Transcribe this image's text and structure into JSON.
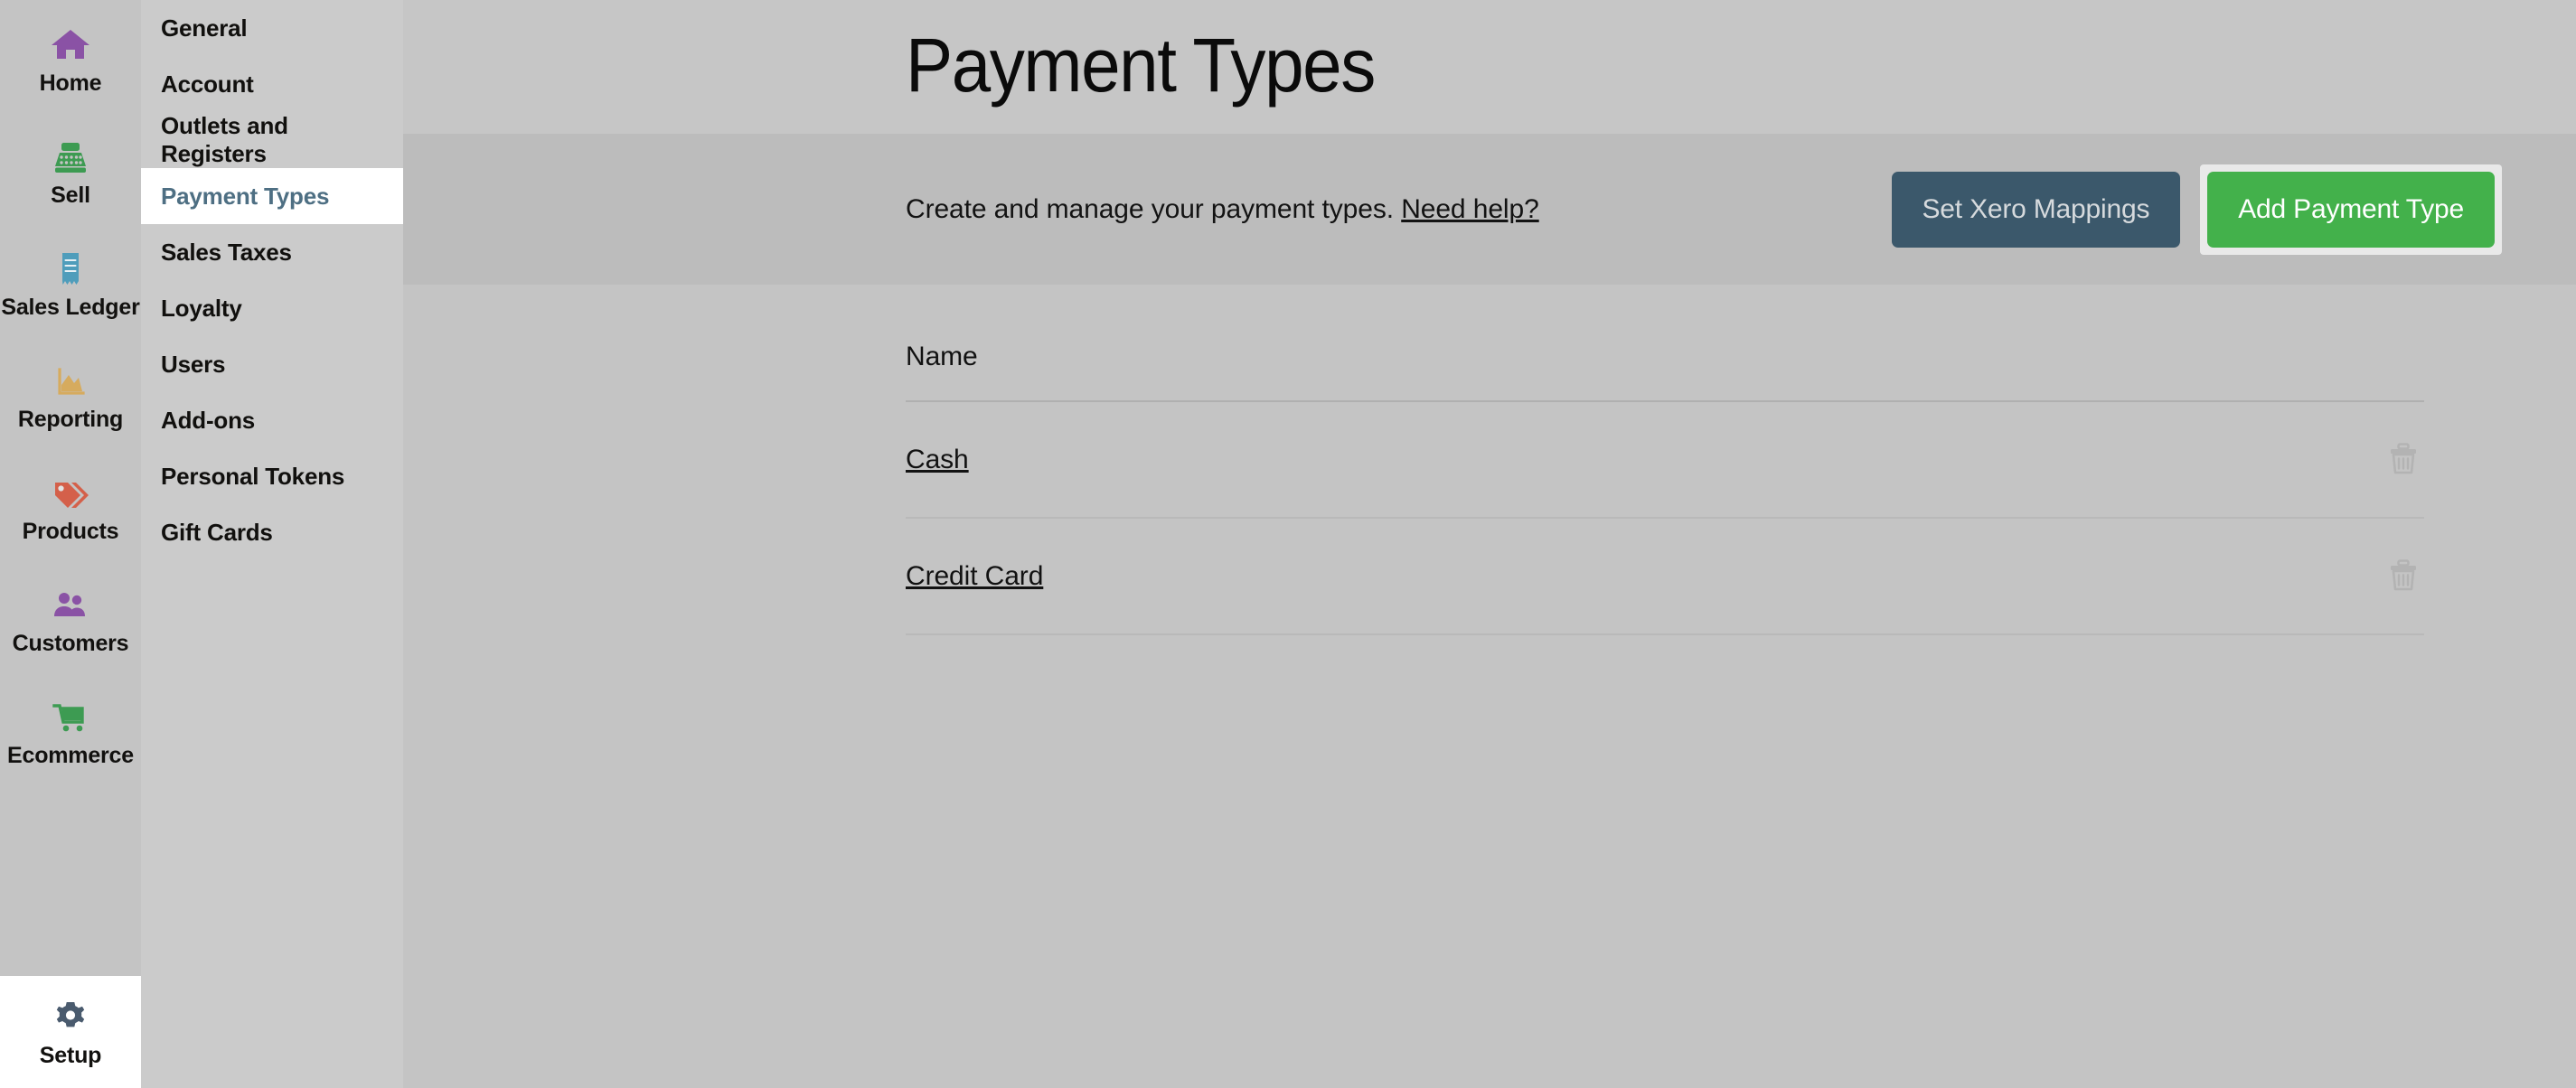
{
  "rail": {
    "items": [
      {
        "label": "Home",
        "icon": "home-icon",
        "color": "#8a52a5",
        "active": false
      },
      {
        "label": "Sell",
        "icon": "register-icon",
        "color": "#3d9b52",
        "active": false
      },
      {
        "label": "Sales Ledger",
        "icon": "receipt-icon",
        "color": "#4f9dbb",
        "active": false
      },
      {
        "label": "Reporting",
        "icon": "area-chart-icon",
        "color": "#d6ab5e",
        "active": false
      },
      {
        "label": "Products",
        "icon": "price-tag-icon",
        "color": "#d4604a",
        "active": false
      },
      {
        "label": "Customers",
        "icon": "people-icon",
        "color": "#8a52a5",
        "active": false
      },
      {
        "label": "Ecommerce",
        "icon": "shopping-cart-icon",
        "color": "#3d9b52",
        "active": false
      },
      {
        "label": "Setup",
        "icon": "gear-icon",
        "color": "#4a5b६e",
        "active": true
      }
    ]
  },
  "subnav": {
    "items": [
      {
        "label": "General",
        "active": false
      },
      {
        "label": "Account",
        "active": false
      },
      {
        "label": "Outlets and Registers",
        "active": false
      },
      {
        "label": "Payment Types",
        "active": true
      },
      {
        "label": "Sales Taxes",
        "active": false
      },
      {
        "label": "Loyalty",
        "active": false
      },
      {
        "label": "Users",
        "active": false
      },
      {
        "label": "Add-ons",
        "active": false
      },
      {
        "label": "Personal Tokens",
        "active": false
      },
      {
        "label": "Gift Cards",
        "active": false
      }
    ]
  },
  "header": {
    "title": "Payment Types"
  },
  "subheader": {
    "description": "Create and manage your payment types.",
    "help_link": "Need help?",
    "xero_button": "Set Xero Mappings",
    "add_button": "Add Payment Type"
  },
  "table": {
    "columns": [
      "Name"
    ],
    "rows": [
      {
        "name": "Cash",
        "delete_icon": "trash-icon"
      },
      {
        "name": "Credit Card",
        "delete_icon": "trash-icon"
      }
    ]
  },
  "colors": {
    "page_background": "#c4c4c4",
    "title_band": "#c6c6c6",
    "subheader_band": "#bcbcbc",
    "subnav_background": "#cbcbcb",
    "active_item_background": "#ffffff",
    "active_item_text": "#4e6f83",
    "primary_button": "#43b14b",
    "secondary_button": "#3b586b",
    "focus_ring": "#e9e9e9"
  }
}
